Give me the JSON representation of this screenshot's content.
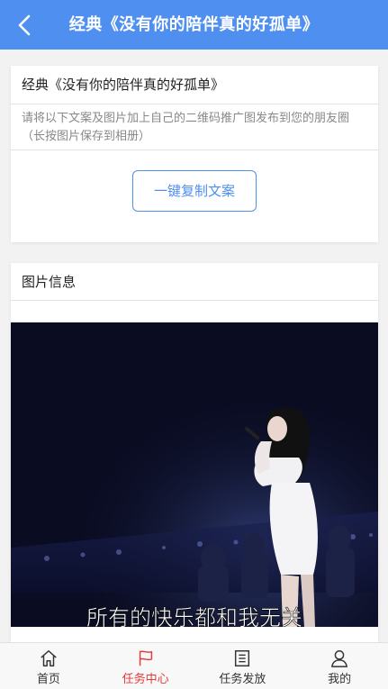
{
  "header": {
    "title": "经典《没有你的陪伴真的好孤单》"
  },
  "post": {
    "title": "经典《没有你的陪伴真的好孤单》",
    "instruction": "请将以下文案及图片加上自己的二维码推广图发布到您的朋友圈（长按图片保存到相册）",
    "copy_button": "一键复制文案"
  },
  "image_section": {
    "title": "图片信息",
    "subtitle_text": "所有的快乐都和我无关"
  },
  "tabbar": {
    "items": [
      {
        "label": "首页",
        "icon": "home-icon"
      },
      {
        "label": "任务中心",
        "icon": "flag-icon",
        "active": true
      },
      {
        "label": "任务发放",
        "icon": "list-icon"
      },
      {
        "label": "我的",
        "icon": "user-icon"
      }
    ]
  },
  "colors": {
    "header_bg": "#4f8ff0",
    "accent": "#4f8ff0",
    "active_tab": "#e83a3a"
  }
}
